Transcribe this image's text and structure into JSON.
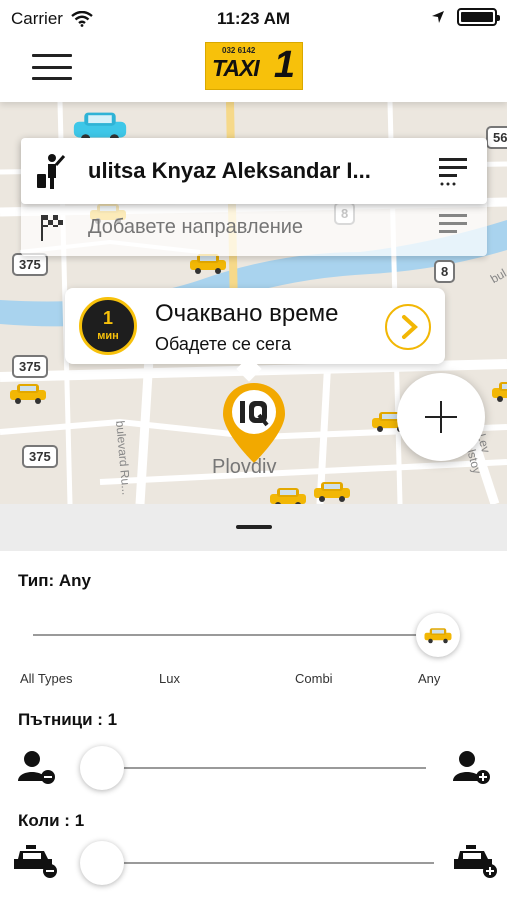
{
  "status_bar": {
    "carrier": "Carrier",
    "time": "11:23 AM"
  },
  "header": {
    "logo": {
      "phone": "032 6142",
      "word": "TAXI",
      "number": "1"
    }
  },
  "map": {
    "city_label": "Plovdiv",
    "street_labels": [
      "bulevard Ru...",
      "Lev Tolstoy",
      "bul"
    ],
    "road_numbers": [
      "375",
      "375",
      "375",
      "8",
      "8",
      "56"
    ]
  },
  "route": {
    "pickup_address": "ulitsa Knyaz Aleksandar I...",
    "destination_placeholder": "Добавете направление"
  },
  "eta": {
    "value": "1",
    "unit": "мин",
    "title": "Очаквано време",
    "subtitle": "Обадете се сега"
  },
  "filters": {
    "type": {
      "label": "Тип: Any",
      "options": [
        "All Types",
        "Lux",
        "Combi",
        "Any"
      ],
      "selected_index": 3
    },
    "passengers": {
      "label": "Пътници : 1",
      "value": 1
    },
    "cars": {
      "label": "Коли : 1",
      "value": 1
    }
  },
  "colors": {
    "accent": "#f7c10b",
    "dark": "#1e1e1e",
    "water": "#a9d3ee"
  },
  "icons": [
    "wifi-icon",
    "location-arrow-icon",
    "battery-icon",
    "menu-icon",
    "hail-person-icon",
    "checkered-flag-icon",
    "list-icon",
    "chevron-right-icon",
    "plus-icon",
    "taxi-icon",
    "person-minus-icon",
    "person-plus-icon",
    "car-minus-icon",
    "car-plus-icon"
  ]
}
